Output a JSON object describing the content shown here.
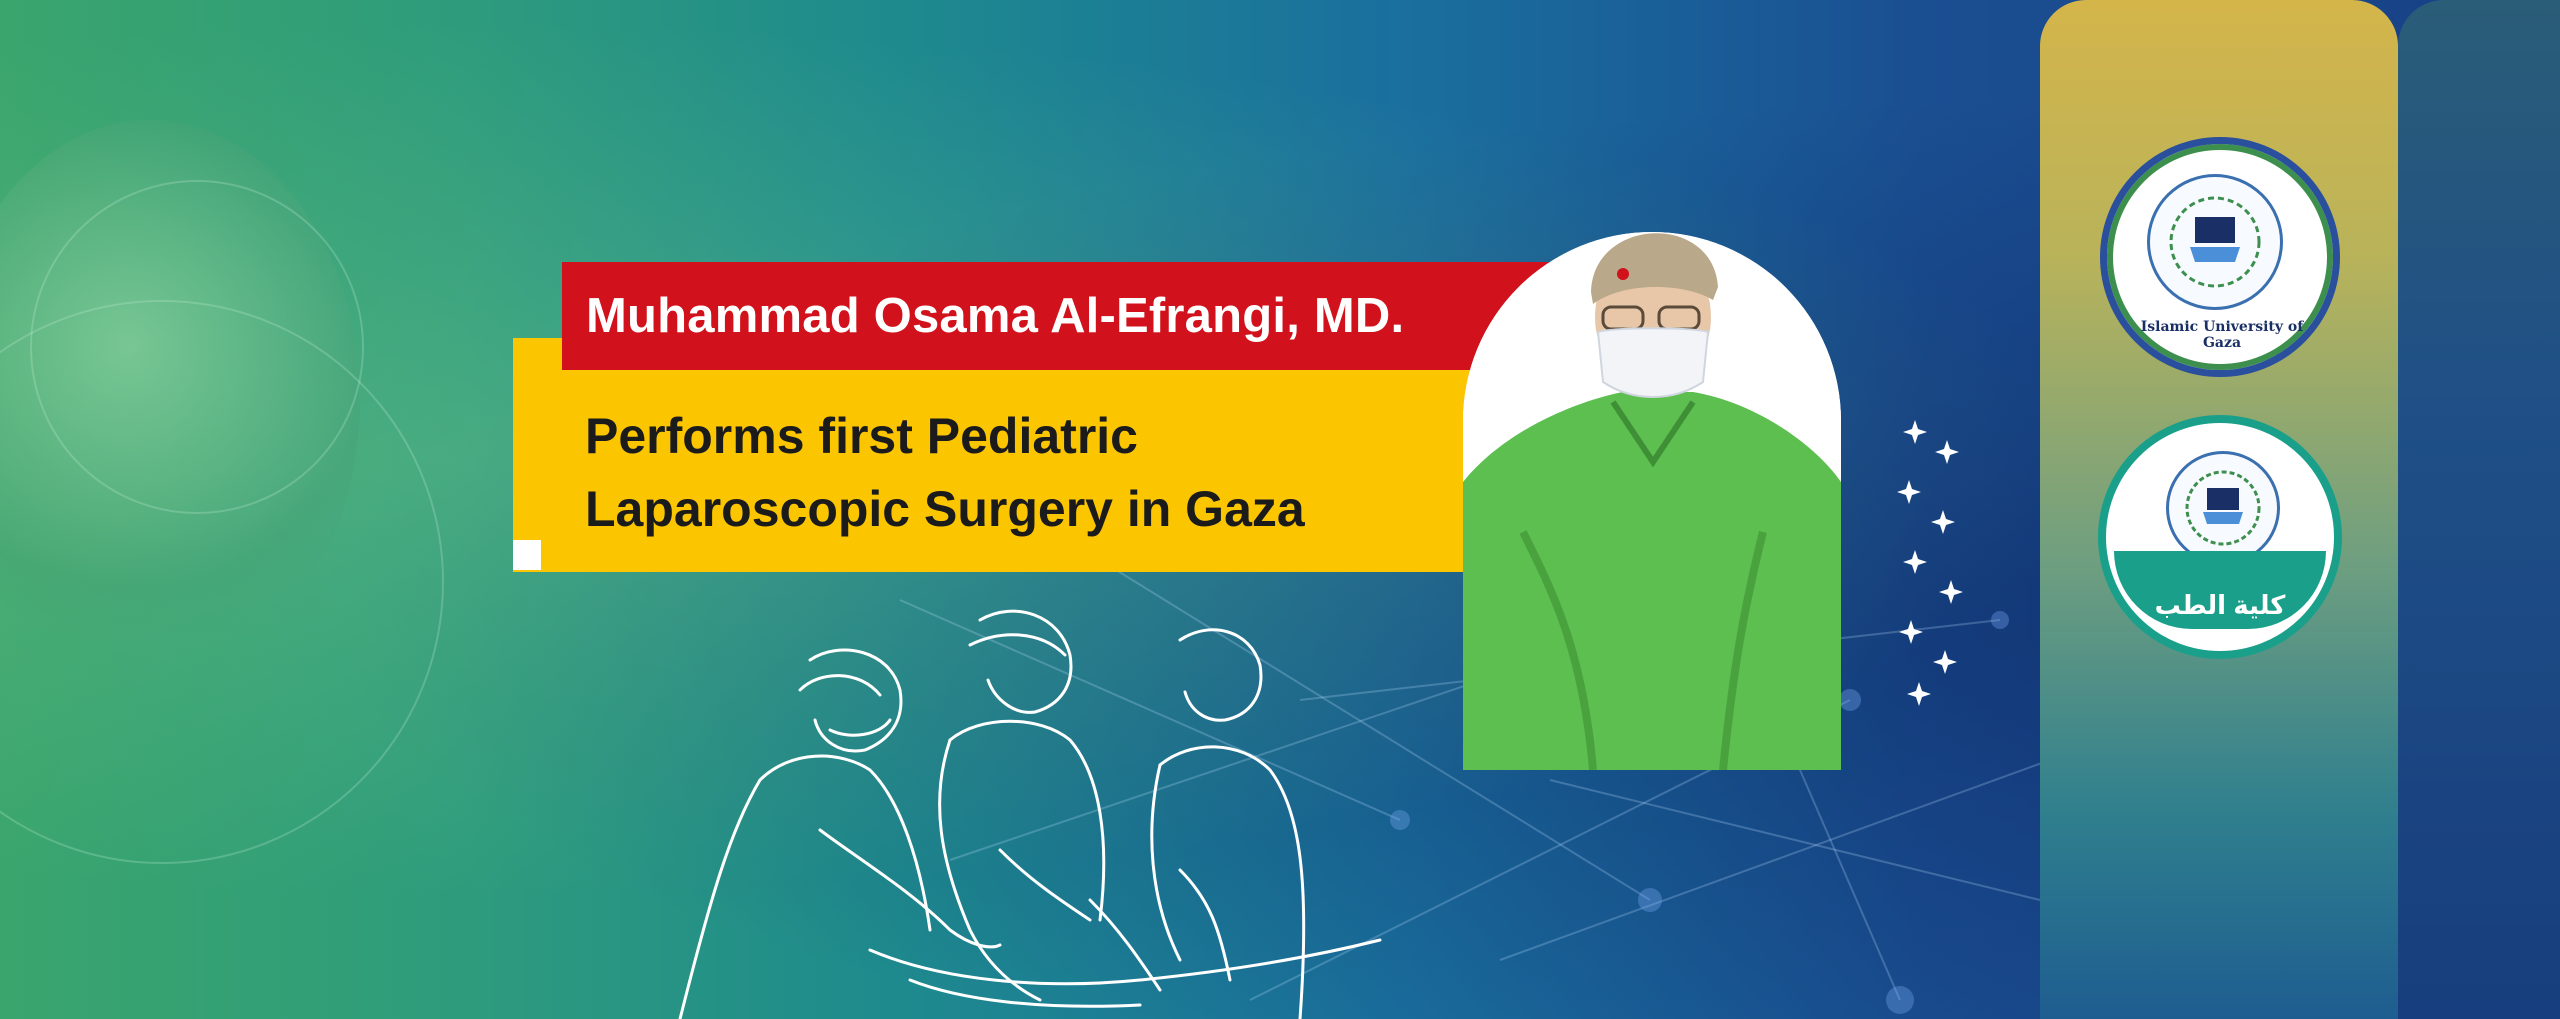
{
  "banner": {
    "name_line": "Muhammad Osama Al-Efrangi, MD.",
    "headline_line1": "Performs first Pediatric",
    "headline_line2": "Laparoscopic Surgery in Gaza"
  },
  "logos": {
    "university_name": "Islamic University of Gaza",
    "faculty_label": "كلية الطب"
  },
  "colors": {
    "name_bar": "#d1111b",
    "headline_card": "#fbc500",
    "name_text": "#ffffff",
    "headline_text": "#1b1b1b",
    "faculty_teal": "#1aa08a",
    "university_blue": "#2a4f9c"
  },
  "icons": [
    "surgeons-line-art",
    "doctor-photo",
    "sparkle-dots",
    "university-seal-logo",
    "medicine-faculty-logo"
  ]
}
